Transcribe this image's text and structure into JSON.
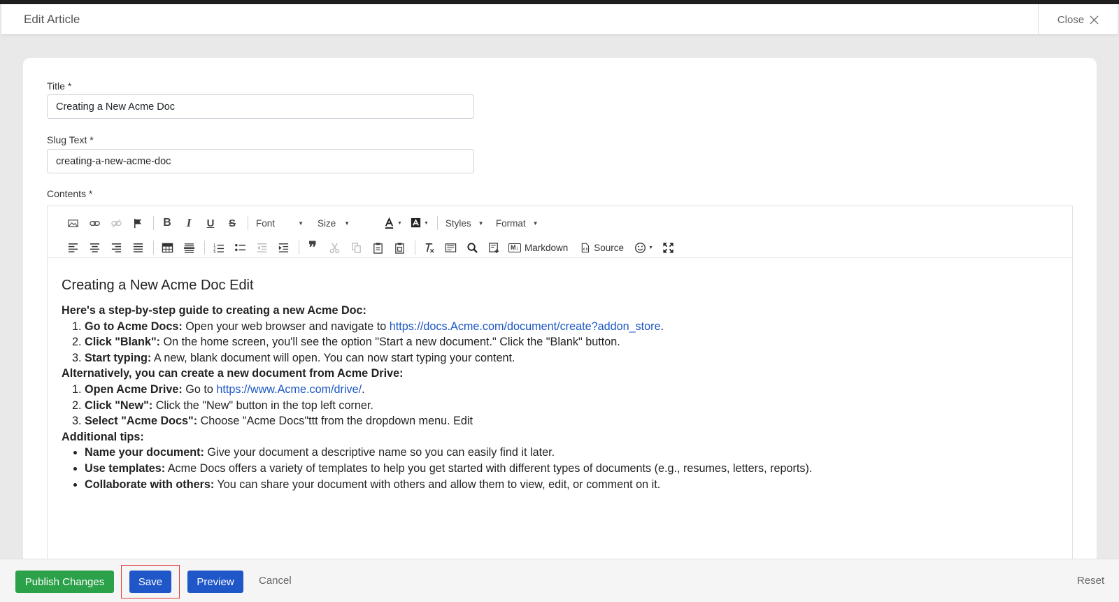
{
  "header": {
    "title": "Edit Article",
    "close_label": "Close"
  },
  "form": {
    "title_label": "Title *",
    "title_value": "Creating a New Acme Doc",
    "slug_label": "Slug Text *",
    "slug_value": "creating-a-new-acme-doc",
    "contents_label": "Contents *"
  },
  "toolbar": {
    "font_label": "Font",
    "size_label": "Size",
    "styles_label": "Styles",
    "format_label": "Format",
    "markdown_label": "Markdown",
    "source_label": "Source",
    "bold_glyph": "B",
    "italic_glyph": "I",
    "underline_glyph": "U",
    "strike_glyph": "S",
    "quote_glyph": "❞",
    "markdown_badge": "M↓"
  },
  "content": {
    "heading": "Creating a New Acme Doc Edit",
    "intro": "Here's a step-by-step guide to creating a new Acme Doc:",
    "steps1": [
      {
        "bold": "Go to Acme Docs:",
        "text": " Open your web browser and navigate to ",
        "link": "https://docs.Acme.com/document/create?addon_store",
        "after": "."
      },
      {
        "bold": "Click \"Blank\":",
        "text": " On the home screen, you'll see the option \"Start a new document.\" Click the \"Blank\" button."
      },
      {
        "bold": "Start typing:",
        "text": " A new, blank document will open. You can now start typing your content."
      }
    ],
    "alt_intro": "Alternatively, you can create a new document from Acme Drive:",
    "steps2": [
      {
        "bold": "Open Acme Drive:",
        "text": " Go to ",
        "link": "https://www.Acme.com/drive/",
        "after": "."
      },
      {
        "bold": "Click \"New\":",
        "text": " Click the \"New\" button in the top left corner."
      },
      {
        "bold": "Select \"Acme Docs\":",
        "text": " Choose \"Acme Docs\"ttt from the dropdown menu. Edit"
      }
    ],
    "tips_intro": "Additional tips:",
    "tips": [
      {
        "bold": "Name your document:",
        "text": " Give your document a descriptive name so you can easily find it later."
      },
      {
        "bold": "Use templates:",
        "text": " Acme Docs offers a variety of templates to help you get started with different types of documents (e.g., resumes, letters, reports)."
      },
      {
        "bold": "Collaborate with others:",
        "text": " You can share your document with others and allow them to view, edit, or comment on it."
      }
    ]
  },
  "footer": {
    "publish_label": "Publish Changes",
    "save_label": "Save",
    "preview_label": "Preview",
    "cancel_label": "Cancel",
    "reset_label": "Reset"
  },
  "colors": {
    "publish": "#2ba149",
    "primary": "#1f56c8",
    "highlight": "#e23c3c",
    "link": "#1a56c4"
  }
}
